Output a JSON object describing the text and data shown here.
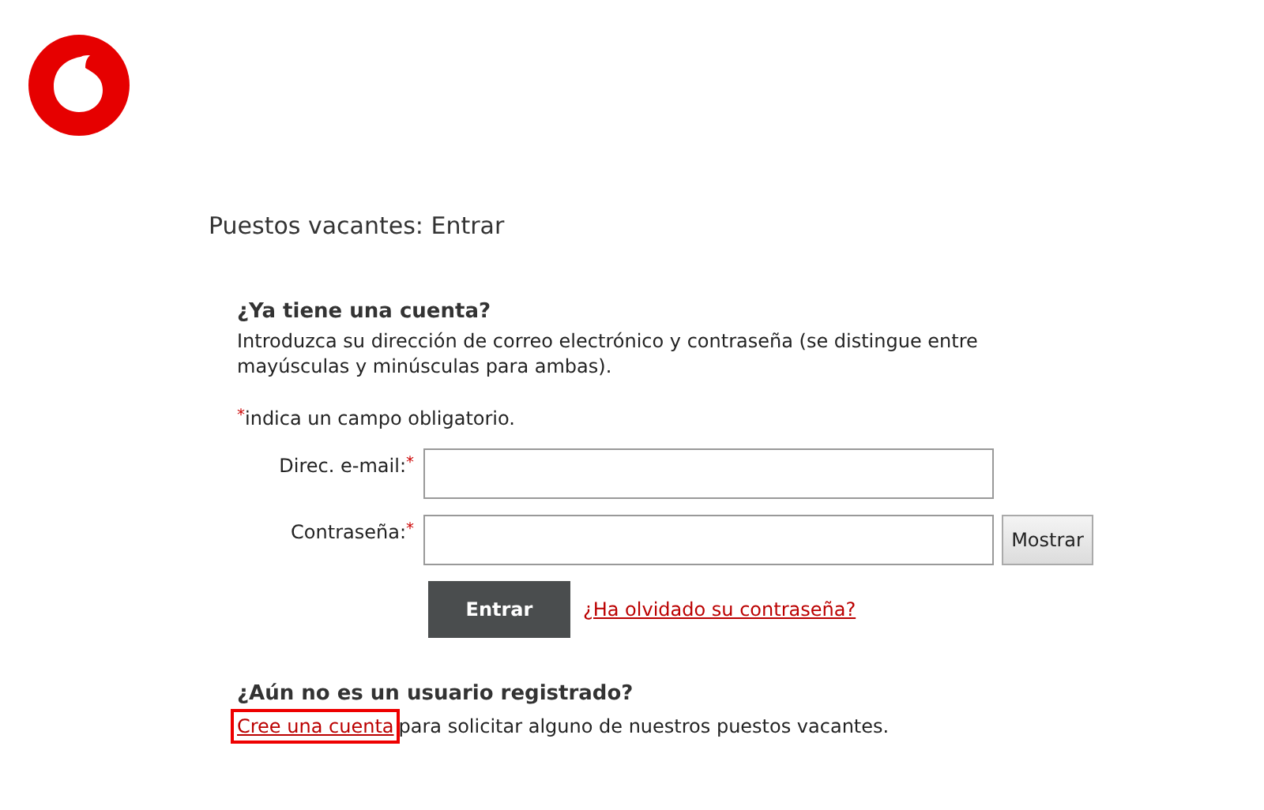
{
  "page_title": "Puestos vacantes: Entrar",
  "login": {
    "heading": "¿Ya tiene una cuenta?",
    "intro": "Introduzca su dirección de correo electrónico y contraseña (se distingue entre mayúsculas y minúsculas para ambas).",
    "required_note": {
      "mark": "*",
      "text": "indica un campo obligatorio."
    },
    "fields": [
      {
        "label": "Direc. e-mail:",
        "required_mark": "*"
      },
      {
        "label": "Contraseña:",
        "required_mark": "*",
        "button": "Mostrar"
      }
    ],
    "submit": "Entrar",
    "forgot_link": "¿Ha olvidado su contraseña?"
  },
  "register": {
    "heading": "¿Aún no es un usuario registrado?",
    "link": "Cree una cuenta",
    "link_highlighted": true,
    "text": "para solicitar alguno de nuestros puestos vacantes."
  }
}
